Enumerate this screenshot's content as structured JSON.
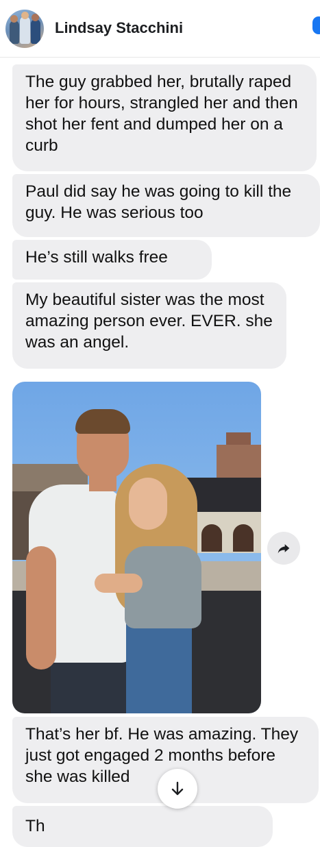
{
  "header": {
    "contact_name": "Lindsay Stacchini",
    "avatar_icon": "group-profile-photo"
  },
  "messages": [
    {
      "text": "The guy grabbed her, brutally raped her for hours, strangled her and then shot her fent and dumped her on a curb"
    },
    {
      "text": "Paul did say he was going to kill the guy. He was serious too"
    },
    {
      "text": "He’s still walks free"
    },
    {
      "text": "My beautiful sister was the most amazing person ever. EVER. she was an angel."
    },
    {
      "text": "That’s her bf. He was amazing. They just got engaged 2 months before she was killed"
    },
    {
      "text": "Th"
    }
  ],
  "photo": {
    "icon": "couple-photo"
  },
  "icons": {
    "share": "share-arrow-icon",
    "scroll_down": "arrow-down-icon"
  },
  "colors": {
    "bubble": "#eeeef0",
    "accent": "#1877f2"
  }
}
